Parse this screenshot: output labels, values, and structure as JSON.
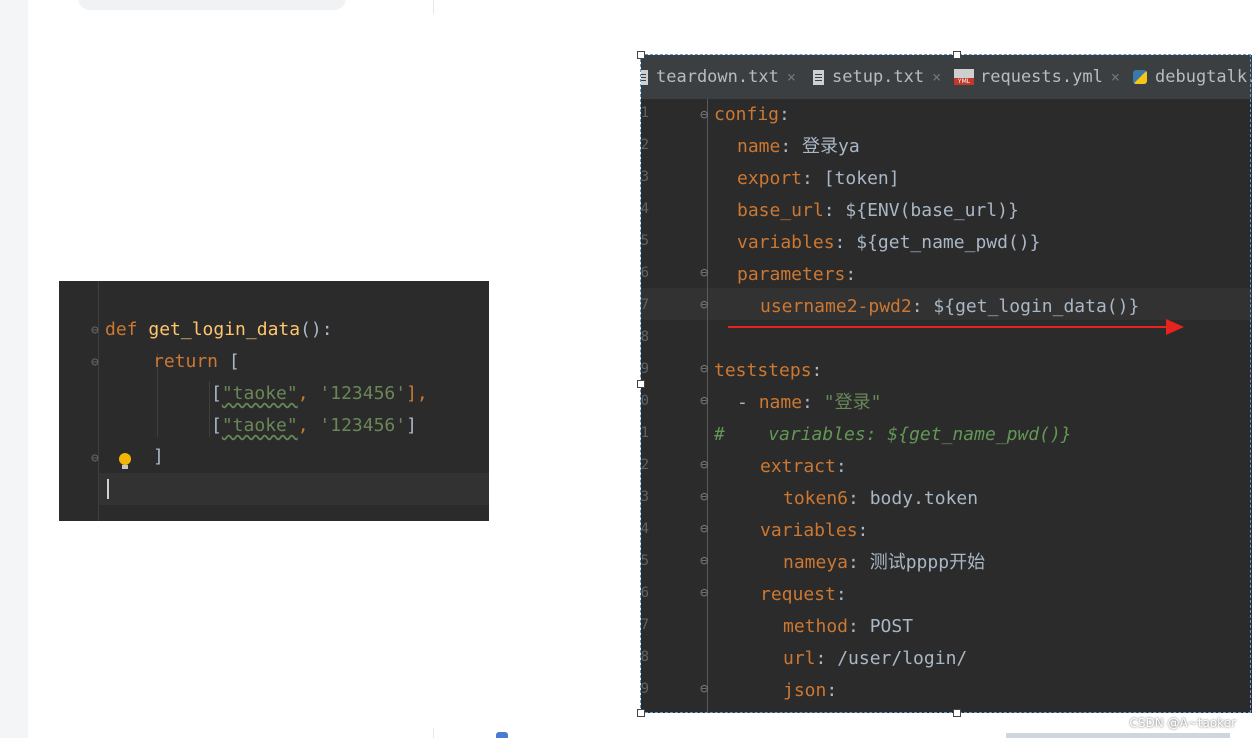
{
  "snippet": {
    "line1": {
      "kw": "def",
      "fn": "get_login_data",
      "rest": "():"
    },
    "line2": {
      "kw": "return",
      "rest": " ["
    },
    "line3": {
      "open": "[",
      "s1": "\"taoke\"",
      "sep": ", ",
      "s2": "'123456'",
      "close": "],"
    },
    "line4": {
      "open": "[",
      "s1": "\"taoke\"",
      "sep": ", ",
      "s2": "'123456'",
      "close": "]"
    },
    "line5": {
      "rest": "]"
    }
  },
  "ide": {
    "tabs": [
      {
        "label": "teardown.txt",
        "icon": "text-file-icon"
      },
      {
        "label": "setup.txt",
        "icon": "text-file-icon"
      },
      {
        "label": "requests.yml",
        "icon": "yml-file-icon"
      },
      {
        "label": "debugtalk.p",
        "icon": "python-file-icon"
      }
    ],
    "close_glyph": "×",
    "line_numbers": [
      "1",
      "2",
      "3",
      "4",
      "5",
      "6",
      "7",
      "8",
      "9",
      "0",
      "1",
      "2",
      "3",
      "4",
      "5",
      "6",
      "7",
      "8",
      "9"
    ],
    "code": {
      "config": "config",
      "name_key": "name",
      "name_val": "登录ya",
      "export_key": "export",
      "export_val": "[token]",
      "base_url_key": "base_url",
      "base_url_val": "${ENV(base_url)}",
      "variables_key": "variables",
      "variables_val": "${get_name_pwd()}",
      "parameters_key": "parameters",
      "up_key": "username2-pwd2",
      "up_val": "${get_login_data()}",
      "teststeps": "teststeps",
      "step_dash": "- ",
      "step_name_key": "name",
      "step_name_val": "\"登录\"",
      "comment_hash": "#",
      "comment_text": "variables: ${get_name_pwd()}",
      "extract_key": "extract",
      "token_key": "token6",
      "token_val": "body.token",
      "variables2_key": "variables",
      "nameya_key": "nameya",
      "nameya_val": "测试pppp开始",
      "request_key": "request",
      "method_key": "method",
      "method_val": "POST",
      "url_key": "url",
      "url_val": "/user/login/",
      "json_key": "json",
      "colon": ":"
    }
  },
  "colors": {
    "annotation_arrow": "#e8231f",
    "keyword": "#cc7832",
    "string": "#6a8759",
    "function": "#ffc66d"
  },
  "watermark": "CSDN @A~taoker"
}
